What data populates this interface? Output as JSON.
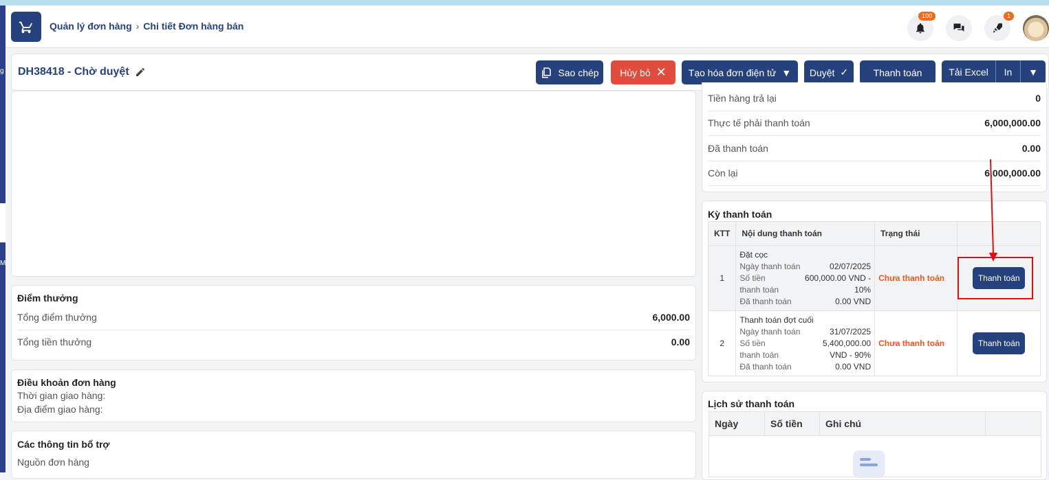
{
  "breadcrumb": {
    "parent": "Quản lý đơn hàng",
    "current": "Chi tiết Đơn hàng bán"
  },
  "header": {
    "notif_count": "100",
    "rocket_count": "1"
  },
  "order": {
    "title": "DH38418 - Chờ duyệt"
  },
  "actions": {
    "copy": "Sao chép",
    "cancel": "Hủy bỏ",
    "einvoice": "Tạo hóa đơn điện tử",
    "approve": "Duyệt",
    "pay": "Thanh toán",
    "excel": "Tải Excel",
    "print": "In"
  },
  "summary": [
    {
      "label": "Tiền hàng trả lại",
      "value": "0"
    },
    {
      "label": "Thực tế phải thanh toán",
      "value": "6,000,000.00"
    },
    {
      "label": "Đã thanh toán",
      "value": "0.00"
    },
    {
      "label": "Còn lại",
      "value": "6,000,000.00"
    }
  ],
  "schedule": {
    "title": "Kỳ thanh toán",
    "headers": [
      "KTT",
      "Nội dung thanh toán",
      "Trạng thái",
      ""
    ],
    "rows": [
      {
        "no": "1",
        "name": "Đặt cọc",
        "date_label": "Ngày thanh toán",
        "date": "02/07/2025",
        "amount_label": "Số tiền thanh toán",
        "amount": "600,000.00 VND - 10%",
        "paid_label": "Đã thanh toán",
        "paid": "0.00 VND",
        "status": "Chưa thanh toán",
        "button": "Thanh toán"
      },
      {
        "no": "2",
        "name": "Thanh toán đợt cuối",
        "date_label": "Ngày thanh toán",
        "date": "31/07/2025",
        "amount_label": "Số tiền thanh toán",
        "amount": "5,400,000.00 VND - 90%",
        "paid_label": "Đã thanh toán",
        "paid": "0.00 VND",
        "status": "Chưa thanh toán",
        "button": "Thanh toán"
      }
    ]
  },
  "history": {
    "title": "Lịch sử thanh toán",
    "headers": [
      "Ngày",
      "Số tiền",
      "Ghi chú"
    ]
  },
  "points": {
    "title": "Điểm thưởng",
    "total_points_label": "Tổng điểm thưởng",
    "total_points": "6,000.00",
    "total_reward_label": "Tổng tiền thưởng",
    "total_reward": "0.00"
  },
  "terms": {
    "title": "Điều khoản đơn hàng",
    "delivery_time": "Thời gian giao hàng:",
    "delivery_place": "Địa điểm giao hàng:"
  },
  "extra": {
    "title": "Các thông tin bổ trợ",
    "source": "Nguồn đơn hàng"
  },
  "colors": {
    "primary": "#26427e",
    "danger": "#e14d3c",
    "status": "#f0561c",
    "highlight": "#e01010"
  }
}
